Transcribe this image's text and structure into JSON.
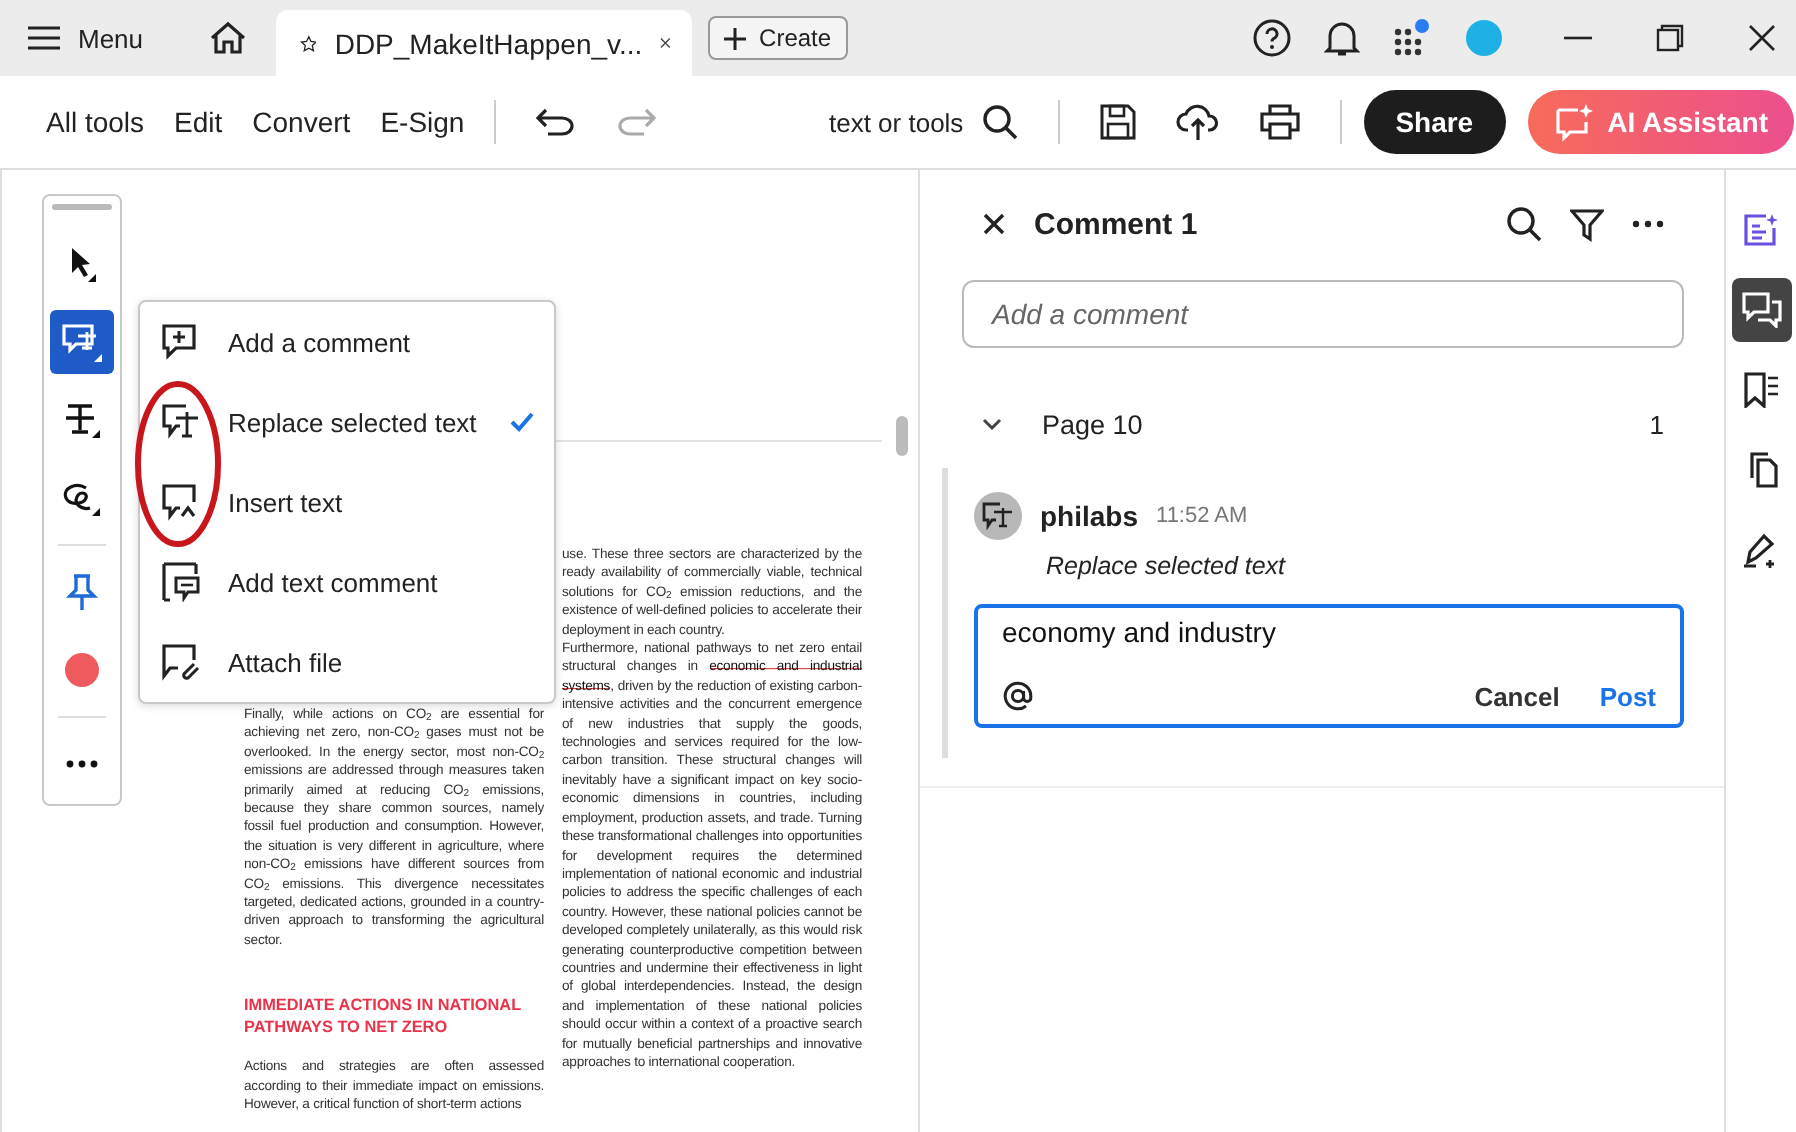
{
  "tabbar": {
    "menu": "Menu",
    "tab_title": "DDP_MakeItHappen_v...",
    "create": "Create"
  },
  "toolbar": {
    "items": [
      "All tools",
      "Edit",
      "Convert",
      "E-Sign"
    ],
    "search": "text or tools",
    "share": "Share",
    "ai": "AI Assistant"
  },
  "tools": [
    {
      "kind": "select",
      "selected": false
    },
    {
      "kind": "comment",
      "selected": true
    },
    {
      "kind": "strike",
      "selected": false
    },
    {
      "kind": "draw",
      "selected": false
    },
    {
      "kind": "pin",
      "selected": false
    },
    {
      "kind": "color",
      "selected": false
    },
    {
      "kind": "more",
      "selected": false
    }
  ],
  "menu": [
    {
      "kind": "add-comment",
      "label": "Add a comment",
      "checked": false
    },
    {
      "kind": "replace",
      "label": "Replace selected text",
      "checked": true
    },
    {
      "kind": "insert",
      "label": "Insert text",
      "checked": false
    },
    {
      "kind": "text-comment",
      "label": "Add text comment",
      "checked": false
    },
    {
      "kind": "attach",
      "label": "Attach file",
      "checked": false
    }
  ],
  "document": {
    "left_paragraphs": [
      "Finally, while actions on CO$_{2}$ are essential for achieving net zero, non-CO$_{2}$ gases must not be overlooked. In the energy sector, most non-CO$_{2}$ emissions are addressed through measures taken primarily aimed at reducing CO$_{2}$ emissions, because they share common sources, namely fossil fuel production and consumption. However, the situation is very different in agriculture, where non-CO$_{2}$ emissions have different sources from CO$_{2}$ emissions. This divergence necessitates targeted, dedicated actions, grounded in a country-driven approach to transforming the agricultural sector."
    ],
    "heading": "IMMEDIATE ACTIONS IN NATIONAL PATHWAYS TO NET ZERO",
    "after_heading": [
      "Actions and strategies are often assessed according to their immediate impact on emissions. However, a critical function of short-term actions"
    ],
    "right_paragraph": "use. These three sectors are characterized by the ready availability of commercially viable, technical solutions for CO$_{2}$ emission reductions, and the existence of well-defined policies to accelerate their deployment in each country.",
    "edited_paragraph": {
      "before": "Furthermore, national pathways to net zero entail structural changes in ",
      "struck": "economic and industrial systems",
      "after": ", driven by the reduction of existing carbon-intensive activities and the concurrent emergence of new industries that supply the goods, technologies and services required for the low-carbon transition. These structural changes will inevitably have a significant impact on key socio-economic dimensions in countries, including employment, production assets, and trade. Turning these transformational challenges into opportunities for development requires the determined implementation of national economic and industrial policies to address the specific challenges of each country. However, these national policies cannot be developed completely unilaterally, as this would risk generating counterproductive competition between countries and undermine their effectiveness in light of global interdependencies. Instead, the design and implementation of these national policies should occur within a context of a proactive search for mutually beneficial partnerships and innovative approaches to international cooperation."
    }
  },
  "comments": {
    "title": "Comment 1",
    "add_placeholder": "Add a comment",
    "page": {
      "label": "Page 10",
      "count": "1",
      "expanded": true
    },
    "entry": {
      "author": "philabs",
      "time": "11:52 AM",
      "type": "Replace selected text"
    },
    "reply": {
      "value": "economy and industry",
      "cancel": "Cancel",
      "post": "Post"
    }
  },
  "rail": [
    {
      "kind": "ai-summary",
      "selected": false
    },
    {
      "kind": "comments",
      "selected": true
    },
    {
      "kind": "bookmarks",
      "selected": false
    },
    {
      "kind": "pages",
      "selected": false
    },
    {
      "kind": "sign",
      "selected": false
    }
  ]
}
